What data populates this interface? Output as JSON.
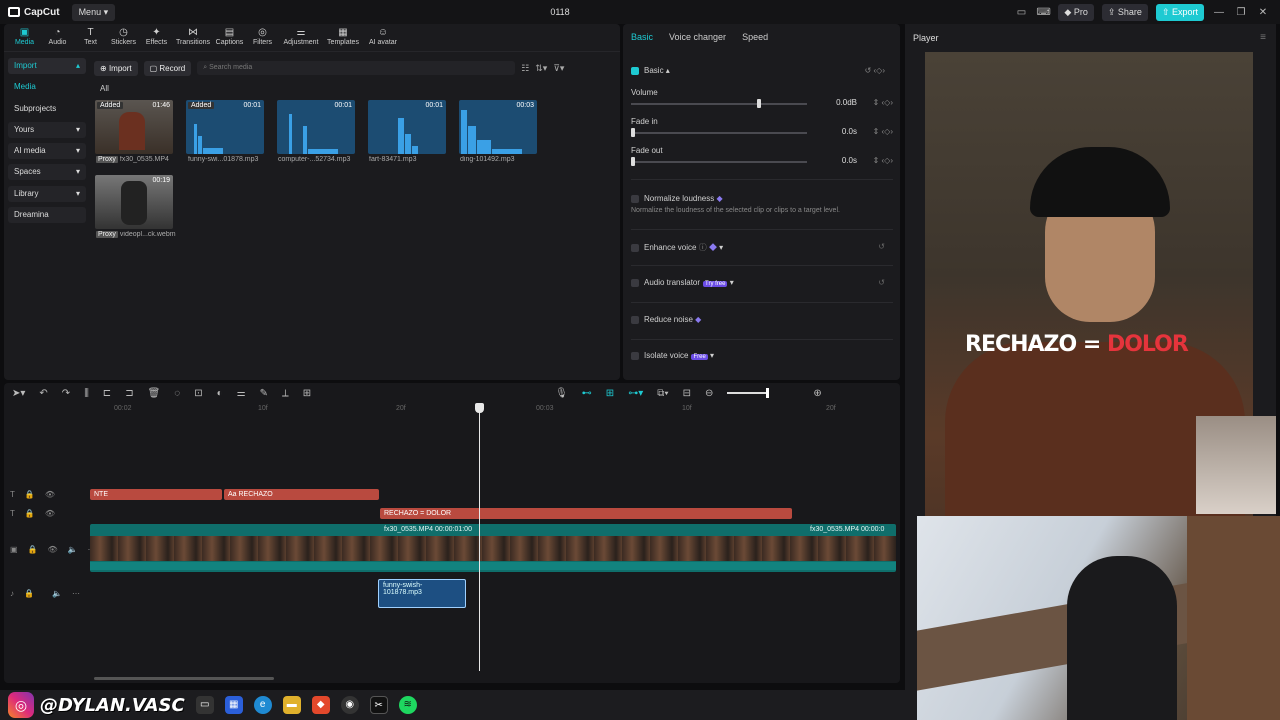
{
  "app": {
    "title": "0118",
    "menu_label": "Menu",
    "logo_text": "CapCut"
  },
  "titlebar": {
    "pro_label": "Pro",
    "share_label": "Share",
    "export_label": "Export"
  },
  "toolbar": {
    "items": [
      "Media",
      "Audio",
      "Text",
      "Stickers",
      "Effects",
      "Transitions",
      "Captions",
      "Filters",
      "Adjustment",
      "Templates",
      "AI avatar"
    ]
  },
  "sidebar": {
    "items": [
      {
        "label": "Import",
        "arrow": "▴"
      },
      {
        "label": "Media",
        "arrow": ""
      },
      {
        "label": "Subprojects",
        "arrow": ""
      },
      {
        "label": "Yours",
        "arrow": "▾"
      },
      {
        "label": "AI media",
        "arrow": "▾"
      },
      {
        "label": "Spaces",
        "arrow": "▾"
      },
      {
        "label": "Library",
        "arrow": "▾"
      },
      {
        "label": "Dreamina",
        "arrow": ""
      }
    ]
  },
  "media": {
    "import_label": "Import",
    "record_label": "Record",
    "search_placeholder": "Search media",
    "all_label": "All",
    "proxy_label": "Proxy",
    "added_label": "Added",
    "items": [
      {
        "name": "fx30_0535.MP4",
        "duration": "01:46"
      },
      {
        "name": "funny-swi...01878.mp3",
        "duration": "00:01"
      },
      {
        "name": "computer-...52734.mp3",
        "duration": "00:01"
      },
      {
        "name": "fart-83471.mp3",
        "duration": "00:01"
      },
      {
        "name": "ding-101492.mp3",
        "duration": "00:03"
      },
      {
        "name": "videopl...ck.webm",
        "duration": "00:19"
      }
    ]
  },
  "settings": {
    "tabs": [
      "Basic",
      "Voice changer",
      "Speed"
    ],
    "section_title": "Basic",
    "volume": {
      "label": "Volume",
      "value": "0.0dB",
      "level": 0.73
    },
    "fade_in": {
      "label": "Fade in",
      "value": "0.0s",
      "level": 0
    },
    "fade_out": {
      "label": "Fade out",
      "value": "0.0s",
      "level": 0
    },
    "normalize": {
      "label": "Normalize loudness",
      "hint": "Normalize the loudness of the selected clip or clips to a target level."
    },
    "enhance": {
      "label": "Enhance voice"
    },
    "translator": {
      "label": "Audio translator",
      "tag": "Try free"
    },
    "reduce_noise": {
      "label": "Reduce noise"
    },
    "isolate": {
      "label": "Isolate voice",
      "tag": "Free"
    }
  },
  "player": {
    "title": "Player",
    "overlay_white": "RECHAZO = ",
    "overlay_red": "DOLOR"
  },
  "timeline": {
    "ruler": [
      "00:02",
      "10f",
      "20f",
      "00:03",
      "10f",
      "20f"
    ],
    "text_clips": [
      {
        "label": "NTE"
      },
      {
        "label": "Aa RECHAZO"
      },
      {
        "label": "RECHAZO = DOLOR"
      }
    ],
    "video_clip_labels": [
      "fx30_0535.MP4   00:00:01:00",
      "fx30_0535.MP4   00:00:0"
    ],
    "audio_clip_label": "funny-swish-101878.mp3"
  },
  "taskbar": {
    "handle": "@DYLAN.VASC"
  }
}
